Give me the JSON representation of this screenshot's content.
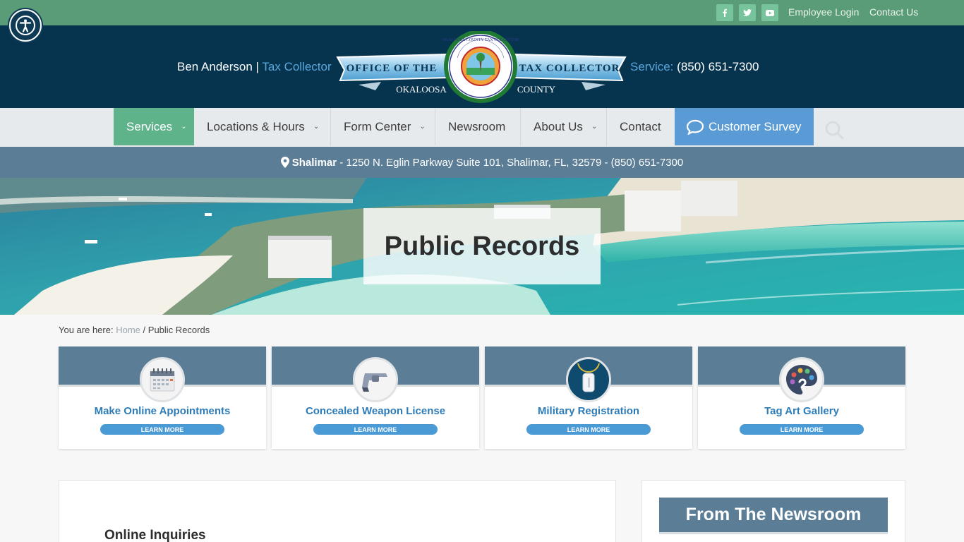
{
  "topbar": {
    "social": [
      "facebook-icon",
      "twitter-icon",
      "youtube-icon"
    ],
    "links": [
      "Employee Login",
      "Contact Us"
    ]
  },
  "header": {
    "name": "Ben Anderson",
    "separator": "|",
    "role": "Tax Collector",
    "service_label": "Service:",
    "service_phone": "(850) 651-7300",
    "logo": {
      "left_banner": "OFFICE OF THE",
      "right_banner": "TAX COLLECTOR",
      "bottom_left": "OKALOOSA",
      "bottom_right": "COUNTY",
      "seal_text": "OKALOOSA COUNTY TAX COLLECTOR"
    }
  },
  "nav": {
    "items": [
      {
        "label": "Services",
        "dropdown": true,
        "active": true
      },
      {
        "label": "Locations & Hours",
        "dropdown": true
      },
      {
        "label": "Form Center",
        "dropdown": true
      },
      {
        "label": "Newsroom",
        "dropdown": false
      },
      {
        "label": "About Us",
        "dropdown": true
      },
      {
        "label": "Contact",
        "dropdown": false
      }
    ],
    "survey_label": "Customer Survey"
  },
  "location": {
    "name": "Shalimar",
    "details": "- 1250 N. Eglin Parkway Suite 101, Shalimar, FL, 32579 - (850) 651-7300"
  },
  "hero": {
    "title": "Public Records"
  },
  "breadcrumb": {
    "prefix": "You are here:",
    "home": "Home",
    "sep": "/",
    "current": "Public Records"
  },
  "cards": [
    {
      "title": "Make Online Appointments",
      "button": "LEARN MORE",
      "icon": "calendar-icon"
    },
    {
      "title": "Concealed Weapon License",
      "button": "LEARN MORE",
      "icon": "revolver-icon"
    },
    {
      "title": "Military Registration",
      "button": "LEARN MORE",
      "icon": "dog-tag-icon"
    },
    {
      "title": "Tag Art Gallery",
      "button": "LEARN MORE",
      "icon": "palette-icon"
    }
  ],
  "content": {
    "heading": "Online Inquiries"
  },
  "sidebar": {
    "heading": "From The Newsroom"
  },
  "colors": {
    "topbar": "#5a9c78",
    "header": "#06344f",
    "nav_active": "#5fb38a",
    "survey": "#5a9bd5",
    "slate": "#5b7d96",
    "link_blue": "#2d7cb8"
  }
}
